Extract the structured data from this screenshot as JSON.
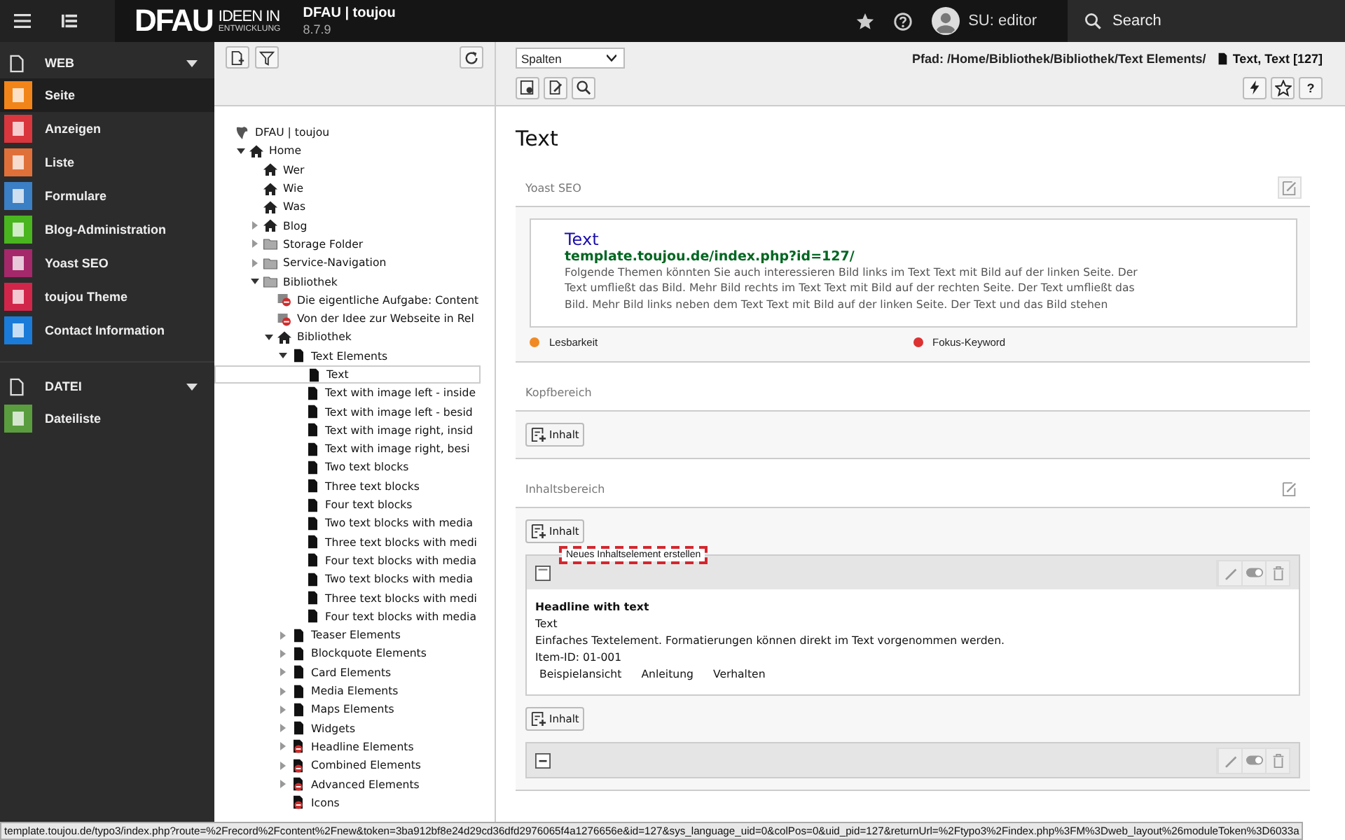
{
  "topbar": {
    "logo": "DFAU",
    "tagline_top": "IDEEN IN",
    "tagline_bottom": "ENTWICKLUNG",
    "site_name": "DFAU | toujou",
    "version": "8.7.9",
    "user": "SU: editor",
    "search": "Search"
  },
  "sidebar": {
    "groups": [
      {
        "label": "WEB",
        "expanded": true,
        "items": [
          {
            "label": "Seite",
            "color": "#f18519",
            "selected": true
          },
          {
            "label": "Anzeigen",
            "color": "#d9363e",
            "selected": false
          },
          {
            "label": "Liste",
            "color": "#e0703a",
            "selected": false
          },
          {
            "label": "Formulare",
            "color": "#3b7fc4",
            "selected": false
          },
          {
            "label": "Blog-Administration",
            "color": "#49b51f",
            "selected": false
          },
          {
            "label": "Yoast SEO",
            "color": "#a4286a",
            "selected": false
          },
          {
            "label": "toujou Theme",
            "color": "#d1264a",
            "selected": false
          },
          {
            "label": "Contact Information",
            "color": "#1a7bd8",
            "selected": false
          }
        ]
      },
      {
        "label": "DATEI",
        "expanded": true,
        "items": [
          {
            "label": "Dateiliste",
            "color": "#5a9d3f",
            "selected": false
          }
        ]
      }
    ]
  },
  "tree": {
    "items": [
      {
        "label": "DFAU | toujou",
        "kind": "site",
        "selected": false,
        "children": [
          {
            "label": "Home",
            "kind": "home",
            "expanded": true,
            "selected": false,
            "children": [
              {
                "label": "Wer",
                "kind": "home",
                "selected": false
              },
              {
                "label": "Wie",
                "kind": "home",
                "selected": false
              },
              {
                "label": "Was",
                "kind": "home",
                "selected": false
              },
              {
                "label": "Blog",
                "kind": "home",
                "expanded": false,
                "selected": false
              },
              {
                "label": "Storage Folder",
                "kind": "folder",
                "expanded": false,
                "selected": false
              },
              {
                "label": "Service-Navigation",
                "kind": "folder",
                "expanded": false,
                "selected": false
              },
              {
                "label": "Bibliothek",
                "kind": "folder",
                "expanded": true,
                "selected": false,
                "children": [
                  {
                    "label": "Die eigentliche Aufgabe: Content",
                    "kind": "shortcut-hidden",
                    "selected": false
                  },
                  {
                    "label": "Von der Idee zur Webseite in Rel",
                    "kind": "shortcut-hidden",
                    "selected": false
                  },
                  {
                    "label": "Bibliothek",
                    "kind": "home",
                    "expanded": true,
                    "selected": false,
                    "children": [
                      {
                        "label": "Text Elements",
                        "kind": "page",
                        "expanded": true,
                        "selected": false,
                        "children": [
                          {
                            "label": "Text",
                            "kind": "page",
                            "selected": true
                          },
                          {
                            "label": "Text with image left - inside",
                            "kind": "page",
                            "selected": false
                          },
                          {
                            "label": "Text with image left - besid",
                            "kind": "page",
                            "selected": false
                          },
                          {
                            "label": "Text with image right, insid",
                            "kind": "page",
                            "selected": false
                          },
                          {
                            "label": "Text with image right, besi",
                            "kind": "page",
                            "selected": false
                          },
                          {
                            "label": "Two text blocks",
                            "kind": "page",
                            "selected": false
                          },
                          {
                            "label": "Three text blocks",
                            "kind": "page",
                            "selected": false
                          },
                          {
                            "label": "Four text blocks",
                            "kind": "page",
                            "selected": false
                          },
                          {
                            "label": "Two text blocks with media",
                            "kind": "page",
                            "selected": false
                          },
                          {
                            "label": "Three text blocks with medi",
                            "kind": "page",
                            "selected": false
                          },
                          {
                            "label": "Four text blocks with media",
                            "kind": "page",
                            "selected": false
                          },
                          {
                            "label": "Two text blocks with media",
                            "kind": "page",
                            "selected": false
                          },
                          {
                            "label": "Three text blocks with medi",
                            "kind": "page",
                            "selected": false
                          },
                          {
                            "label": "Four text blocks with media",
                            "kind": "page",
                            "selected": false
                          }
                        ]
                      },
                      {
                        "label": "Teaser Elements",
                        "kind": "page",
                        "expanded": false,
                        "selected": false
                      },
                      {
                        "label": "Blockquote Elements",
                        "kind": "page",
                        "expanded": false,
                        "selected": false
                      },
                      {
                        "label": "Card Elements",
                        "kind": "page",
                        "expanded": false,
                        "selected": false
                      },
                      {
                        "label": "Media Elements",
                        "kind": "page",
                        "expanded": false,
                        "selected": false
                      },
                      {
                        "label": "Maps Elements",
                        "kind": "page",
                        "expanded": false,
                        "selected": false
                      },
                      {
                        "label": "Widgets",
                        "kind": "page",
                        "expanded": false,
                        "selected": false
                      },
                      {
                        "label": "Headline Elements",
                        "kind": "page-hidden",
                        "expanded": false,
                        "selected": false
                      },
                      {
                        "label": "Combined Elements",
                        "kind": "page-hidden",
                        "expanded": false,
                        "selected": false
                      },
                      {
                        "label": "Advanced Elements",
                        "kind": "page-hidden",
                        "expanded": false,
                        "selected": false
                      },
                      {
                        "label": "Icons",
                        "kind": "page-hidden",
                        "selected": false
                      }
                    ]
                  }
                ]
              }
            ]
          }
        ]
      }
    ]
  },
  "docheader": {
    "columns_select": "Spalten",
    "path": "Pfad: /Home/Bibliothek/Bibliothek/Text Elements/",
    "page_title": "Text, Text [127]",
    "help_button": "?"
  },
  "page": {
    "title": "Text",
    "yoast": {
      "title": "Yoast SEO",
      "snippet_title": "Text",
      "snippet_url": "template.toujou.de/index.php?id=127/",
      "snippet_description": "Folgende Themen könnten Sie auch interessieren Bild links im Text Text mit Bild auf der linken Seite. Der Text umfließt das Bild. Mehr Bild rechts im Text Text mit Bild auf der rechten Seite. Der Text umfließt das Bild. Mehr Bild links neben dem Text Text mit Bild auf der linken Seite. Der Text und das Bild stehen",
      "scores": [
        {
          "label": "Lesbarkeit",
          "color": "#f08a24"
        },
        {
          "label": "Fokus-Keyword",
          "color": "#dc3232"
        }
      ]
    },
    "sections": [
      {
        "title": "Kopfbereich",
        "editable": false,
        "items": [
          {
            "kind": "add",
            "label": "Inhalt"
          }
        ]
      },
      {
        "title": "Inhaltsbereich",
        "editable": true,
        "items": [
          {
            "kind": "add",
            "label": "Inhalt",
            "tooltip": "Neues Inhaltselement erstellen"
          },
          {
            "kind": "element",
            "collapsed": false,
            "headline": "Headline with text",
            "type": "Text",
            "description": "Einfaches Textelement. Formatierungen können direkt im Text vorgenommen werden.",
            "item_id": "Item-ID: 01-001",
            "links": [
              "Beispielansicht",
              "Anleitung",
              "Verhalten"
            ]
          },
          {
            "kind": "add",
            "label": "Inhalt"
          },
          {
            "kind": "element",
            "collapsed": true
          }
        ]
      }
    ]
  },
  "status_url": "template.toujou.de/typo3/index.php?route=%2Frecord%2Fcontent%2Fnew&token=3ba912bf8e24d29cd36dfd2976065f4a1276656e&id=127&sys_language_uid=0&colPos=0&uid_pid=127&returnUrl=%2Ftypo3%2Findex.php%3FM%3Dweb_layout%26moduleToken%3D6033a"
}
